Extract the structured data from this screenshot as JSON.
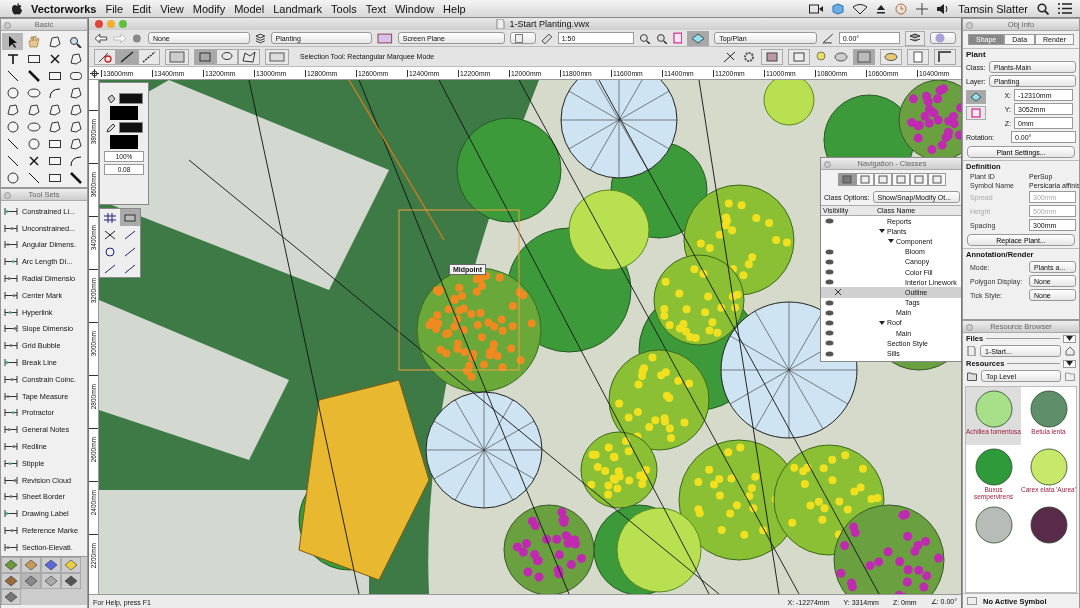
{
  "menubar": {
    "app": "Vectorworks",
    "menus": [
      "File",
      "Edit",
      "View",
      "Modify",
      "Model",
      "Landmark",
      "Tools",
      "Text",
      "Window",
      "Help"
    ],
    "user": "Tamsin Slatter"
  },
  "basic_palette": {
    "title": "Basic"
  },
  "tool_sets": {
    "title": "Tool Sets",
    "tools": [
      "Constrained Li...",
      "Unconstrained...",
      "Angular Dimens.",
      "Arc Length Di...",
      "Radial Dimensio",
      "Center Mark",
      "Hyperlink",
      "Slope Dimensio",
      "Grid Bubble",
      "Break Line",
      "Constrain Coinc.",
      "Tape Measure",
      "Protractor",
      "General Notes",
      "Redline",
      "Stipple",
      "Revision Cloud",
      "Sheet Border",
      "Drawing Label",
      "Reference Marke",
      "Section-Elevati."
    ]
  },
  "document": {
    "title": "1-Start Planting.vwx"
  },
  "view_bar": {
    "class": "None",
    "layer": "Planting",
    "plane": "Screen Plane",
    "scale": "1:50",
    "view": "Top/Plan",
    "angle": "0.00°"
  },
  "mode_bar": {
    "mode_text": "Selection Tool: Rectangular Marquee Mode"
  },
  "top_ruler": [
    "13600mm",
    "13400mm",
    "13200mm",
    "13000mm",
    "12800mm",
    "12600mm",
    "12400mm",
    "12200mm",
    "12000mm",
    "11800mm",
    "11600mm",
    "11400mm",
    "11200mm",
    "11000mm",
    "10800mm",
    "10600mm",
    "10400mm"
  ],
  "side_ruler": [
    "3800mm",
    "3600mm",
    "3400mm",
    "3200mm",
    "3000mm",
    "2800mm",
    "2600mm",
    "2400mm",
    "2200mm"
  ],
  "attributes_palette": {
    "zoom": "100%",
    "line_weight": "0.08"
  },
  "snap_tooltip": "Midpoint",
  "navigation": {
    "title": "Navigation - Classes",
    "options_label": "Class Options:",
    "options_value": "Show/Snap/Modify Ot...",
    "columns": [
      "Visibility",
      "Class Name"
    ],
    "classes": [
      {
        "name": "Reports",
        "kind": "visible",
        "selected": false,
        "expanded": false
      },
      {
        "name": "Plants",
        "kind": "folder",
        "selected": false,
        "expanded": true,
        "children": [
          {
            "name": "Component",
            "kind": "folder",
            "selected": false,
            "expanded": true,
            "children": [
              {
                "name": "Bloom",
                "kind": "visible",
                "selected": false,
                "expanded": false
              },
              {
                "name": "Canopy",
                "kind": "visible",
                "selected": false,
                "expanded": false
              },
              {
                "name": "Color Fill",
                "kind": "visible",
                "selected": false,
                "expanded": false
              },
              {
                "name": "Interior Linework",
                "kind": "visible",
                "selected": false,
                "expanded": false
              },
              {
                "name": "Outline",
                "kind": "hidden",
                "selected": true,
                "expanded": false
              },
              {
                "name": "Tags",
                "kind": "visible",
                "selected": false,
                "expanded": false
              }
            ]
          },
          {
            "name": "Main",
            "kind": "visible",
            "selected": false,
            "expanded": false
          }
        ]
      },
      {
        "name": "Roof",
        "kind": "visible",
        "selected": false,
        "expanded": true,
        "children": [
          {
            "name": "Main",
            "kind": "visible",
            "selected": false,
            "expanded": false
          }
        ]
      },
      {
        "name": "Section Style",
        "kind": "visible",
        "selected": false,
        "expanded": false
      },
      {
        "name": "Sills",
        "kind": "visible",
        "selected": false,
        "expanded": false
      }
    ]
  },
  "obj_info": {
    "title": "Obj Info",
    "tabs": [
      {
        "label": "Shape",
        "selected": true
      },
      {
        "label": "Data",
        "selected": false
      },
      {
        "label": "Render",
        "selected": false
      }
    ],
    "object_type": "Plant",
    "popups": [
      {
        "label": "Class:",
        "value": "Plants-Main"
      },
      {
        "label": "Layer:",
        "value": "Planting"
      }
    ],
    "coords": [
      {
        "label": "X:",
        "value": "-12310mm"
      },
      {
        "label": "Y:",
        "value": "3052mm"
      },
      {
        "label": "Z:",
        "value": "0mm"
      }
    ],
    "rotation": {
      "label": "Rotation:",
      "value": "0.00°"
    },
    "settings_button": "Plant Settings...",
    "definition": {
      "heading": "Definition",
      "rows": [
        {
          "label": "Plant ID",
          "value": "PerSup",
          "kind": "text",
          "disabled": false
        },
        {
          "label": "Symbol Name",
          "value": "Persicaria affinis",
          "kind": "text",
          "disabled": false
        },
        {
          "label": "Spread",
          "value": "300mm",
          "kind": "field",
          "disabled": true
        },
        {
          "label": "Height",
          "value": "500mm",
          "kind": "field",
          "disabled": true
        },
        {
          "label": "Spacing",
          "value": "300mm",
          "kind": "field",
          "disabled": false
        }
      ]
    },
    "replace_button": "Replace Plant...",
    "annotation": {
      "heading": "Annotation/Render",
      "rows": [
        {
          "label": "Mode:",
          "value": "Plants a..."
        },
        {
          "label": "Polygon Display:",
          "value": "None"
        },
        {
          "label": "Tick Style:",
          "value": "None"
        }
      ]
    }
  },
  "resource_browser": {
    "title": "Resource Browser",
    "files_heading": "Files",
    "file": "1-Start...",
    "resources_heading": "Resources",
    "folder": "Top Level",
    "symbols": [
      {
        "name": "Achillea tomentosa",
        "color": "#a8e08a",
        "selected": true
      },
      {
        "name": "Betula lenta",
        "color": "#5e8f6a",
        "selected": false
      },
      {
        "name": "Buxus sempervirens",
        "color": "#2f9a3a",
        "selected": false
      },
      {
        "name": "Carex elata 'Aurea'",
        "color": "#c8e86a",
        "selected": false
      },
      {
        "color": "#b8bcb8",
        "selected": false
      },
      {
        "color": "#5a2a4a",
        "selected": false
      }
    ],
    "status": "No Active Symbol"
  },
  "status_bar": {
    "help": "For Help, press F1",
    "coords": [
      "X: -12274mm",
      "Y: 3314mm",
      "Z: 0mm",
      "∠: 0.00°"
    ]
  }
}
